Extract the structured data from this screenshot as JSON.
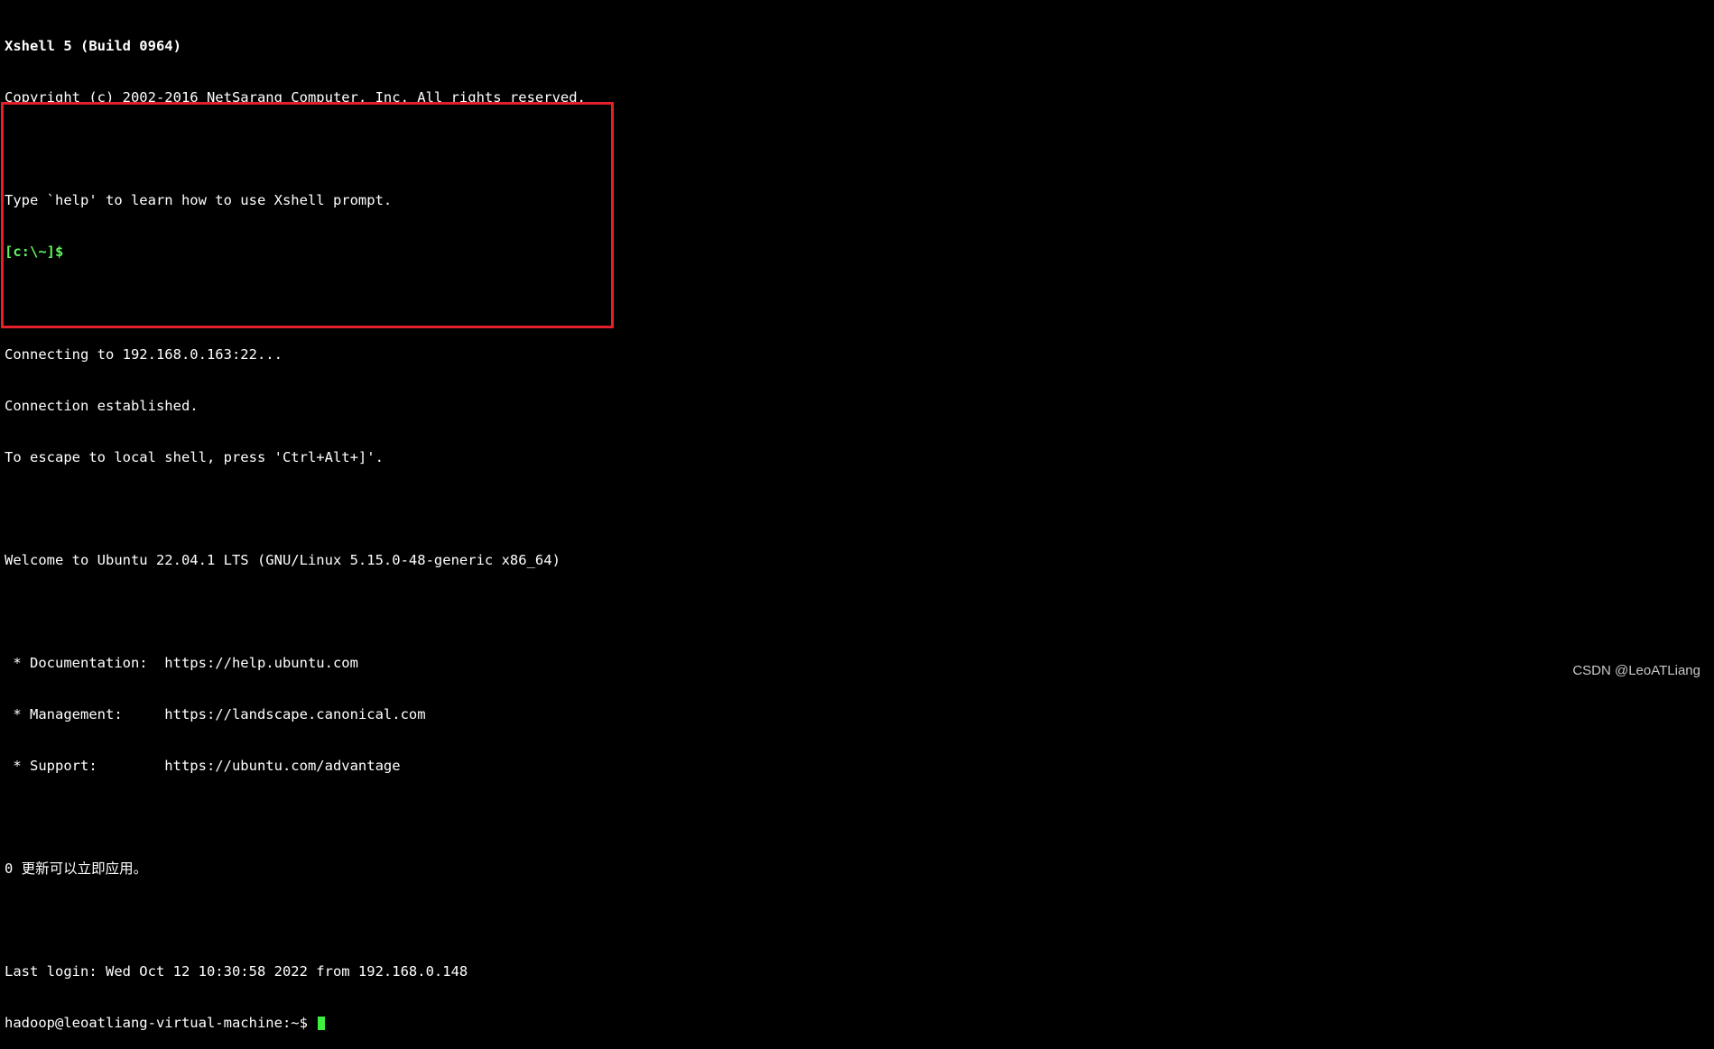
{
  "colors": {
    "background": "#000000",
    "text": "#ffffff",
    "prompt_green": "#5ff55f",
    "highlight_border": "#e5202a",
    "cursor": "#3ef03e"
  },
  "terminal": {
    "banner_title": "Xshell 5 (Build 0964)",
    "copyright": "Copyright (c) 2002-2016 NetSarang Computer, Inc. All rights reserved.",
    "help_hint": "Type `help' to learn how to use Xshell prompt.",
    "local_prompt": "[c:\\~]$",
    "session": {
      "connecting": "Connecting to 192.168.0.163:22...",
      "established": "Connection established.",
      "escape_hint": "To escape to local shell, press 'Ctrl+Alt+]'.",
      "welcome": "Welcome to Ubuntu 22.04.1 LTS (GNU/Linux 5.15.0-48-generic x86_64)",
      "documentation": " * Documentation:  https://help.ubuntu.com",
      "management": " * Management:     https://landscape.canonical.com",
      "support": " * Support:        https://ubuntu.com/advantage",
      "updates": "0 更新可以立即应用。",
      "last_login": "Last login: Wed Oct 12 10:30:58 2022 from 192.168.0.148"
    },
    "remote_prompt": "hadoop@leoatliang-virtual-machine:~$ "
  },
  "watermark": "CSDN @LeoATLiang"
}
